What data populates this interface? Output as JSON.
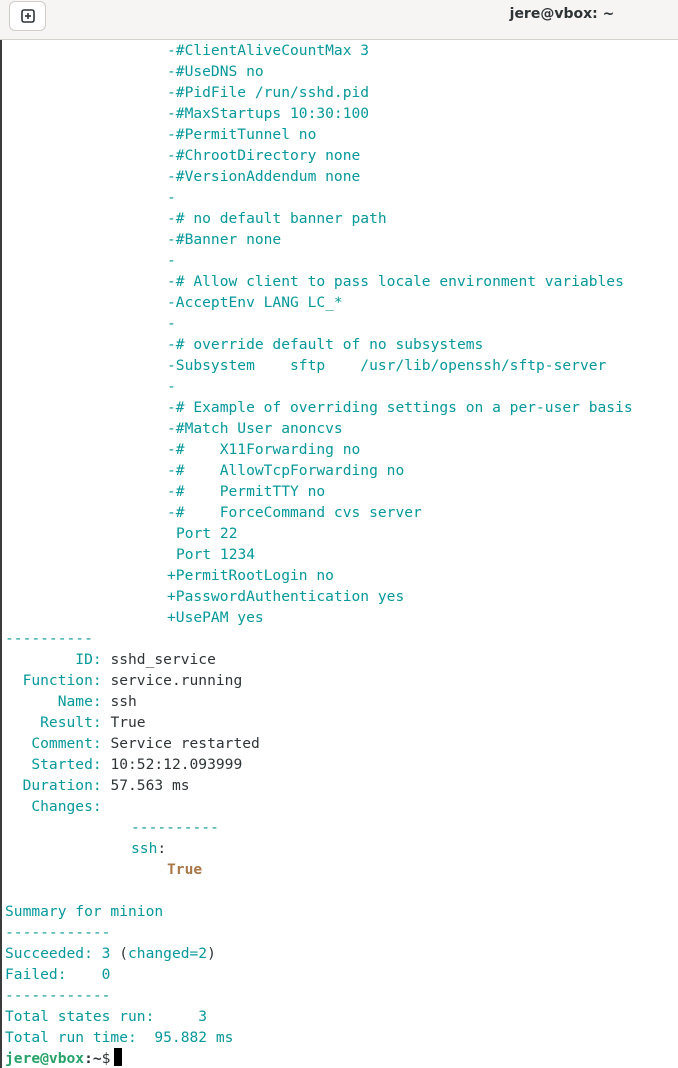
{
  "window": {
    "title": "jere@vbox: ~"
  },
  "icons": {
    "new_tab": "plus-square-icon"
  },
  "colors": {
    "output": "#06989a",
    "text": "#2e3436",
    "changes_value": "#a87745",
    "prompt": "#26a269"
  },
  "terminal": {
    "diff_removed": [
      "-#ClientAliveCountMax 3",
      "-#UseDNS no",
      "-#PidFile /run/sshd.pid",
      "-#MaxStartups 10:30:100",
      "-#PermitTunnel no",
      "-#ChrootDirectory none",
      "-#VersionAddendum none",
      "-",
      "-# no default banner path",
      "-#Banner none",
      "-",
      "-# Allow client to pass locale environment variables",
      "-AcceptEnv LANG LC_*",
      "-",
      "-# override default of no subsystems",
      "-Subsystem    sftp    /usr/lib/openssh/sftp-server",
      "-",
      "-# Example of overriding settings on a per-user basis",
      "-#Match User anoncvs",
      "-#    X11Forwarding no",
      "-#    AllowTcpForwarding no",
      "-#    PermitTTY no",
      "-#    ForceCommand cvs server"
    ],
    "diff_unchanged": [
      "Port 22",
      "Port 1234"
    ],
    "diff_added": [
      "+PermitRootLogin no",
      "+PasswordAuthentication yes",
      "+UsePAM yes"
    ],
    "separator": "----------",
    "state_fields": [
      {
        "label": "        ID:",
        "value": " sshd_service"
      },
      {
        "label": "  Function:",
        "value": " service.running"
      },
      {
        "label": "      Name:",
        "value": " ssh"
      },
      {
        "label": "    Result:",
        "value": " True"
      },
      {
        "label": "   Comment:",
        "value": " Service restarted"
      },
      {
        "label": "   Started:",
        "value": " 10:52:12.093999"
      },
      {
        "label": "  Duration:",
        "value": " 57.563 ms"
      },
      {
        "label": "   Changes:",
        "value": ""
      }
    ],
    "changes": {
      "separator": "----------",
      "key": "ssh",
      "key_suffix": ":",
      "value": "True"
    },
    "summary": {
      "title": "Summary for minion",
      "rule": "------------",
      "succeeded_label": "Succeeded: 3",
      "open_paren": " (",
      "changed": "changed=2",
      "close_paren": ")",
      "failed": "Failed:    0",
      "total_states": "Total states run:     3",
      "total_time": "Total run time:  95.882 ms"
    },
    "prompt": {
      "user_host": "jere@vbox",
      "path": ":~",
      "symbol": "$"
    }
  }
}
